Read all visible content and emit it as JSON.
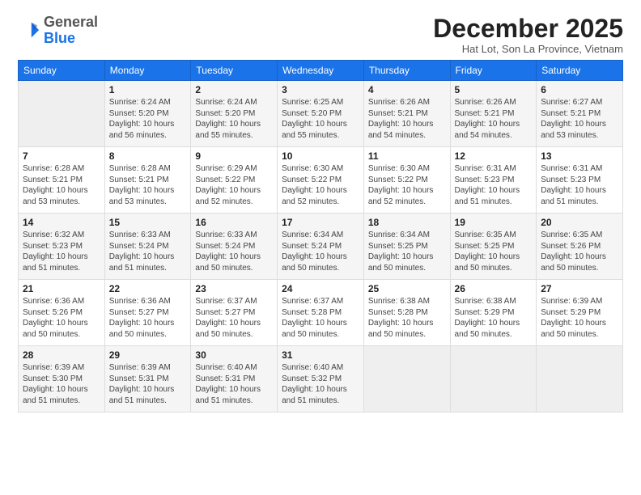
{
  "logo": {
    "general": "General",
    "blue": "Blue"
  },
  "header": {
    "month_title": "December 2025",
    "location": "Hat Lot, Son La Province, Vietnam"
  },
  "weekdays": [
    "Sunday",
    "Monday",
    "Tuesday",
    "Wednesday",
    "Thursday",
    "Friday",
    "Saturday"
  ],
  "rows": [
    [
      {
        "day": "",
        "lines": []
      },
      {
        "day": "1",
        "lines": [
          "Sunrise: 6:24 AM",
          "Sunset: 5:20 PM",
          "Daylight: 10 hours",
          "and 56 minutes."
        ]
      },
      {
        "day": "2",
        "lines": [
          "Sunrise: 6:24 AM",
          "Sunset: 5:20 PM",
          "Daylight: 10 hours",
          "and 55 minutes."
        ]
      },
      {
        "day": "3",
        "lines": [
          "Sunrise: 6:25 AM",
          "Sunset: 5:20 PM",
          "Daylight: 10 hours",
          "and 55 minutes."
        ]
      },
      {
        "day": "4",
        "lines": [
          "Sunrise: 6:26 AM",
          "Sunset: 5:21 PM",
          "Daylight: 10 hours",
          "and 54 minutes."
        ]
      },
      {
        "day": "5",
        "lines": [
          "Sunrise: 6:26 AM",
          "Sunset: 5:21 PM",
          "Daylight: 10 hours",
          "and 54 minutes."
        ]
      },
      {
        "day": "6",
        "lines": [
          "Sunrise: 6:27 AM",
          "Sunset: 5:21 PM",
          "Daylight: 10 hours",
          "and 53 minutes."
        ]
      }
    ],
    [
      {
        "day": "7",
        "lines": [
          "Sunrise: 6:28 AM",
          "Sunset: 5:21 PM",
          "Daylight: 10 hours",
          "and 53 minutes."
        ]
      },
      {
        "day": "8",
        "lines": [
          "Sunrise: 6:28 AM",
          "Sunset: 5:21 PM",
          "Daylight: 10 hours",
          "and 53 minutes."
        ]
      },
      {
        "day": "9",
        "lines": [
          "Sunrise: 6:29 AM",
          "Sunset: 5:22 PM",
          "Daylight: 10 hours",
          "and 52 minutes."
        ]
      },
      {
        "day": "10",
        "lines": [
          "Sunrise: 6:30 AM",
          "Sunset: 5:22 PM",
          "Daylight: 10 hours",
          "and 52 minutes."
        ]
      },
      {
        "day": "11",
        "lines": [
          "Sunrise: 6:30 AM",
          "Sunset: 5:22 PM",
          "Daylight: 10 hours",
          "and 52 minutes."
        ]
      },
      {
        "day": "12",
        "lines": [
          "Sunrise: 6:31 AM",
          "Sunset: 5:23 PM",
          "Daylight: 10 hours",
          "and 51 minutes."
        ]
      },
      {
        "day": "13",
        "lines": [
          "Sunrise: 6:31 AM",
          "Sunset: 5:23 PM",
          "Daylight: 10 hours",
          "and 51 minutes."
        ]
      }
    ],
    [
      {
        "day": "14",
        "lines": [
          "Sunrise: 6:32 AM",
          "Sunset: 5:23 PM",
          "Daylight: 10 hours",
          "and 51 minutes."
        ]
      },
      {
        "day": "15",
        "lines": [
          "Sunrise: 6:33 AM",
          "Sunset: 5:24 PM",
          "Daylight: 10 hours",
          "and 51 minutes."
        ]
      },
      {
        "day": "16",
        "lines": [
          "Sunrise: 6:33 AM",
          "Sunset: 5:24 PM",
          "Daylight: 10 hours",
          "and 50 minutes."
        ]
      },
      {
        "day": "17",
        "lines": [
          "Sunrise: 6:34 AM",
          "Sunset: 5:24 PM",
          "Daylight: 10 hours",
          "and 50 minutes."
        ]
      },
      {
        "day": "18",
        "lines": [
          "Sunrise: 6:34 AM",
          "Sunset: 5:25 PM",
          "Daylight: 10 hours",
          "and 50 minutes."
        ]
      },
      {
        "day": "19",
        "lines": [
          "Sunrise: 6:35 AM",
          "Sunset: 5:25 PM",
          "Daylight: 10 hours",
          "and 50 minutes."
        ]
      },
      {
        "day": "20",
        "lines": [
          "Sunrise: 6:35 AM",
          "Sunset: 5:26 PM",
          "Daylight: 10 hours",
          "and 50 minutes."
        ]
      }
    ],
    [
      {
        "day": "21",
        "lines": [
          "Sunrise: 6:36 AM",
          "Sunset: 5:26 PM",
          "Daylight: 10 hours",
          "and 50 minutes."
        ]
      },
      {
        "day": "22",
        "lines": [
          "Sunrise: 6:36 AM",
          "Sunset: 5:27 PM",
          "Daylight: 10 hours",
          "and 50 minutes."
        ]
      },
      {
        "day": "23",
        "lines": [
          "Sunrise: 6:37 AM",
          "Sunset: 5:27 PM",
          "Daylight: 10 hours",
          "and 50 minutes."
        ]
      },
      {
        "day": "24",
        "lines": [
          "Sunrise: 6:37 AM",
          "Sunset: 5:28 PM",
          "Daylight: 10 hours",
          "and 50 minutes."
        ]
      },
      {
        "day": "25",
        "lines": [
          "Sunrise: 6:38 AM",
          "Sunset: 5:28 PM",
          "Daylight: 10 hours",
          "and 50 minutes."
        ]
      },
      {
        "day": "26",
        "lines": [
          "Sunrise: 6:38 AM",
          "Sunset: 5:29 PM",
          "Daylight: 10 hours",
          "and 50 minutes."
        ]
      },
      {
        "day": "27",
        "lines": [
          "Sunrise: 6:39 AM",
          "Sunset: 5:29 PM",
          "Daylight: 10 hours",
          "and 50 minutes."
        ]
      }
    ],
    [
      {
        "day": "28",
        "lines": [
          "Sunrise: 6:39 AM",
          "Sunset: 5:30 PM",
          "Daylight: 10 hours",
          "and 51 minutes."
        ]
      },
      {
        "day": "29",
        "lines": [
          "Sunrise: 6:39 AM",
          "Sunset: 5:31 PM",
          "Daylight: 10 hours",
          "and 51 minutes."
        ]
      },
      {
        "day": "30",
        "lines": [
          "Sunrise: 6:40 AM",
          "Sunset: 5:31 PM",
          "Daylight: 10 hours",
          "and 51 minutes."
        ]
      },
      {
        "day": "31",
        "lines": [
          "Sunrise: 6:40 AM",
          "Sunset: 5:32 PM",
          "Daylight: 10 hours",
          "and 51 minutes."
        ]
      },
      {
        "day": "",
        "lines": []
      },
      {
        "day": "",
        "lines": []
      },
      {
        "day": "",
        "lines": []
      }
    ]
  ]
}
